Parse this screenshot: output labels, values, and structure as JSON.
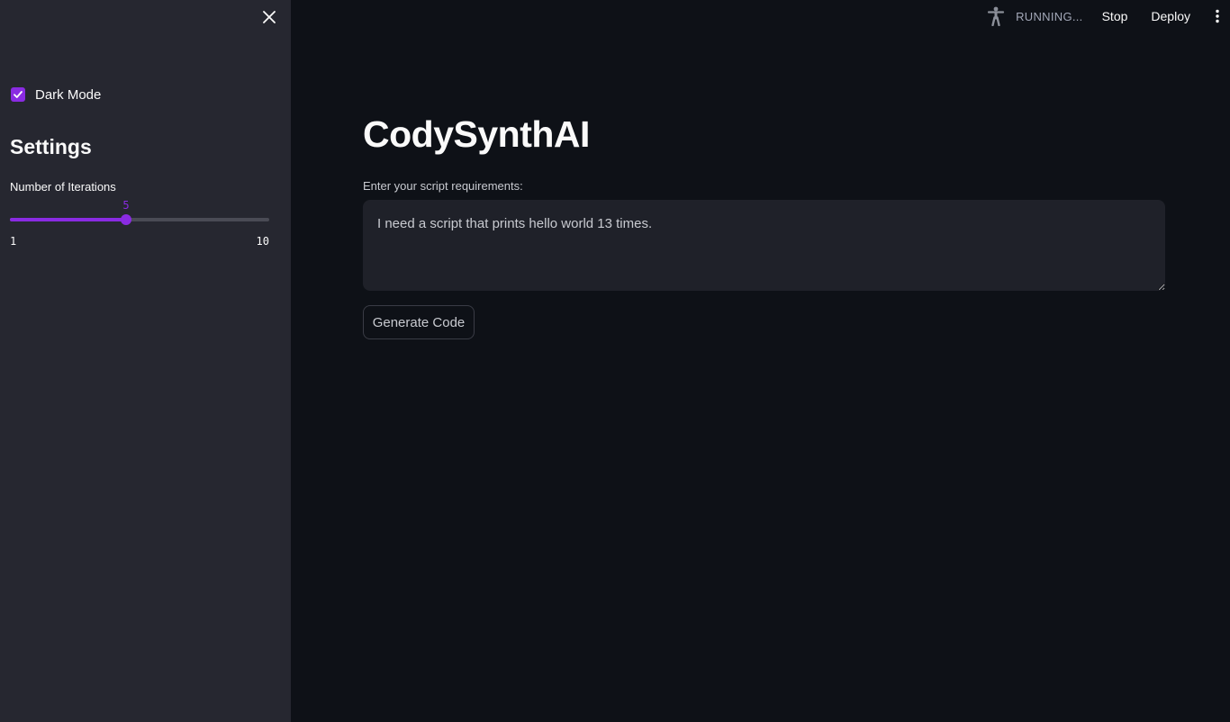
{
  "sidebar": {
    "close_icon": "close-icon",
    "dark_mode": {
      "label": "Dark Mode",
      "checked": true
    },
    "heading": "Settings",
    "iterations_slider": {
      "label": "Number of Iterations",
      "value": "5",
      "min": "1",
      "max": "10"
    }
  },
  "topbar": {
    "running_icon": "running-person-icon",
    "status": "RUNNING...",
    "stop_label": "Stop",
    "deploy_label": "Deploy",
    "menu_icon": "vertical-ellipsis-icon"
  },
  "main": {
    "title": "CodySynthAI",
    "input_label": "Enter your script requirements:",
    "input_value": "I need a script that prints hello world 13 times.",
    "generate_label": "Generate Code"
  },
  "colors": {
    "accent": "#8a2be2",
    "background": "#0e1117",
    "sidebar": "#262730",
    "input_bg": "#1f2129"
  }
}
